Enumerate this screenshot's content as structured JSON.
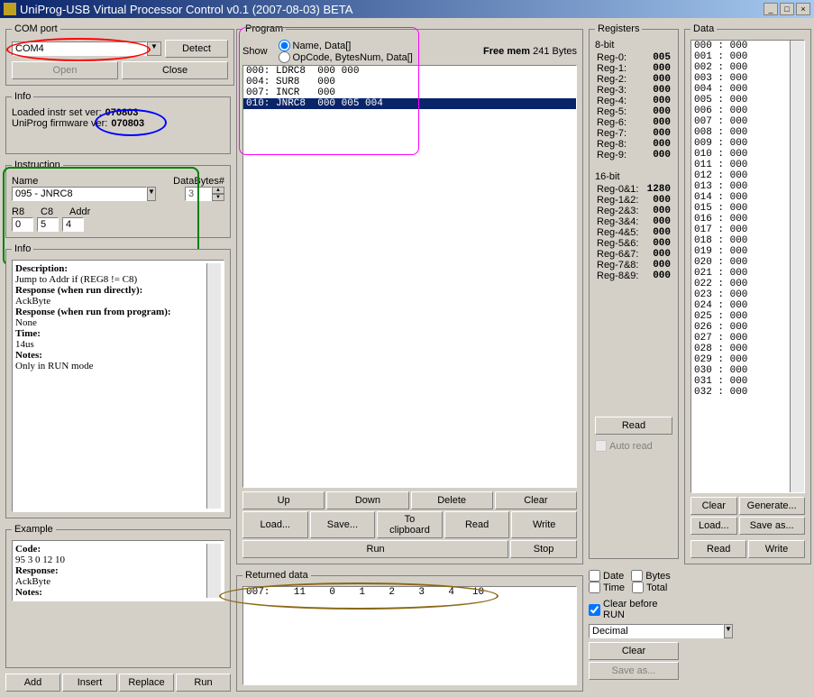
{
  "window": {
    "title": "UniProg-USB Virtual Processor Control v0.1 (2007-08-03) BETA"
  },
  "com": {
    "legend": "COM port",
    "value": "COM4",
    "detect": "Detect",
    "open": "Open",
    "close": "Close"
  },
  "info": {
    "legend": "Info",
    "instr_label": "Loaded instr set ver:",
    "instr_ver": "070803",
    "fw_label": "UniProg firmware ver:",
    "fw_ver": "070803"
  },
  "instruction": {
    "legend": "Instruction",
    "name_label": "Name",
    "databytes_label": "DataBytes#",
    "name_value": "095 - JNRC8",
    "databytes_value": "3",
    "r1": "R8",
    "r2": "C8",
    "r3": "Addr",
    "v1": "0",
    "v2": "5",
    "v3": "4"
  },
  "instinfo": {
    "legend": "Info",
    "desc_h": "Description:",
    "desc": "Jump to Addr if (REG8 != C8)",
    "resp1_h": "Response (when run directly):",
    "resp1": "AckByte",
    "resp2_h": "Response (when run from program):",
    "resp2": "None",
    "time_h": "Time:",
    "time": "14us",
    "notes_h": "Notes:",
    "notes": "Only in RUN mode"
  },
  "example": {
    "legend": "Example",
    "code_h": "Code:",
    "code": "95 3 0 12 10",
    "resp_h": "Response:",
    "resp": "AckByte",
    "notes_h": "Notes:"
  },
  "left_buttons": {
    "add": "Add",
    "insert": "Insert",
    "replace": "Replace",
    "run": "Run"
  },
  "program": {
    "legend": "Program",
    "show": "Show",
    "opt1": "Name, Data[]",
    "opt2": "OpCode, BytesNum, Data[]",
    "freemem_label": "Free mem",
    "freemem": "241 Bytes",
    "lines": [
      "000: LDRC8  000 000",
      "004: SUR8   000",
      "007: INCR   000",
      "010: JNRC8  000 005 004"
    ],
    "selected": 3,
    "up": "Up",
    "down": "Down",
    "delete": "Delete",
    "clear": "Clear",
    "load": "Load...",
    "save": "Save...",
    "clip": "To clipboard",
    "read": "Read",
    "write": "Write",
    "run": "Run",
    "stop": "Stop"
  },
  "returned": {
    "legend": "Returned data",
    "line": "007:    11    0    1    2    3    4   10",
    "date": "Date",
    "bytes": "Bytes",
    "time": "Time",
    "total": "Total",
    "clearbefore": "Clear before RUN",
    "format": "Decimal",
    "clear": "Clear",
    "saveas": "Save as..."
  },
  "registers": {
    "legend": "Registers",
    "eight": "8-bit",
    "regs8": [
      {
        "n": "Reg-0:",
        "v": "005"
      },
      {
        "n": "Reg-1:",
        "v": "000"
      },
      {
        "n": "Reg-2:",
        "v": "000"
      },
      {
        "n": "Reg-3:",
        "v": "000"
      },
      {
        "n": "Reg-4:",
        "v": "000"
      },
      {
        "n": "Reg-5:",
        "v": "000"
      },
      {
        "n": "Reg-6:",
        "v": "000"
      },
      {
        "n": "Reg-7:",
        "v": "000"
      },
      {
        "n": "Reg-8:",
        "v": "000"
      },
      {
        "n": "Reg-9:",
        "v": "000"
      }
    ],
    "sixteen": "16-bit",
    "regs16": [
      {
        "n": "Reg-0&1:",
        "v": "1280"
      },
      {
        "n": "Reg-1&2:",
        "v": "000"
      },
      {
        "n": "Reg-2&3:",
        "v": "000"
      },
      {
        "n": "Reg-3&4:",
        "v": "000"
      },
      {
        "n": "Reg-4&5:",
        "v": "000"
      },
      {
        "n": "Reg-5&6:",
        "v": "000"
      },
      {
        "n": "Reg-6&7:",
        "v": "000"
      },
      {
        "n": "Reg-7&8:",
        "v": "000"
      },
      {
        "n": "Reg-8&9:",
        "v": "000"
      }
    ],
    "read": "Read",
    "autoread": "Auto read"
  },
  "data": {
    "legend": "Data",
    "clear": "Clear",
    "generate": "Generate...",
    "load": "Load...",
    "saveas": "Save as...",
    "read": "Read",
    "write": "Write"
  }
}
